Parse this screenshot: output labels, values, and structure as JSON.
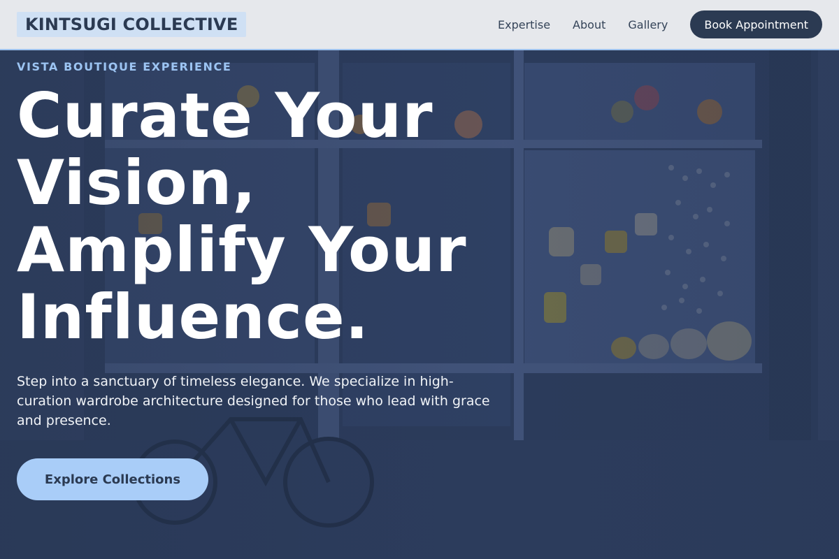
{
  "header": {
    "brand": "KINTSUGI COLLECTIVE",
    "nav": [
      {
        "label": "Expertise"
      },
      {
        "label": "About"
      },
      {
        "label": "Gallery"
      }
    ],
    "cta_label": "Book Appointment"
  },
  "hero": {
    "eyebrow": "VISTA BOUTIQUE EXPERIENCE",
    "headline_lines": [
      "Curate Your",
      "Vision,",
      "Amplify Your",
      "Influence."
    ],
    "subtext": "Step into a sanctuary of timeless elegance. We specialize in high-curation wardrobe architecture designed for those who lead with grace and presence.",
    "cta_label": "Explore Collections",
    "background_image": "storefront-photo"
  },
  "colors": {
    "header_bg": "#e6e8ec",
    "brand_bg": "#cfe0f4",
    "primary_dark": "#2b3a52",
    "accent_light": "#a9cdf8",
    "eyebrow": "#9cc4f2"
  }
}
